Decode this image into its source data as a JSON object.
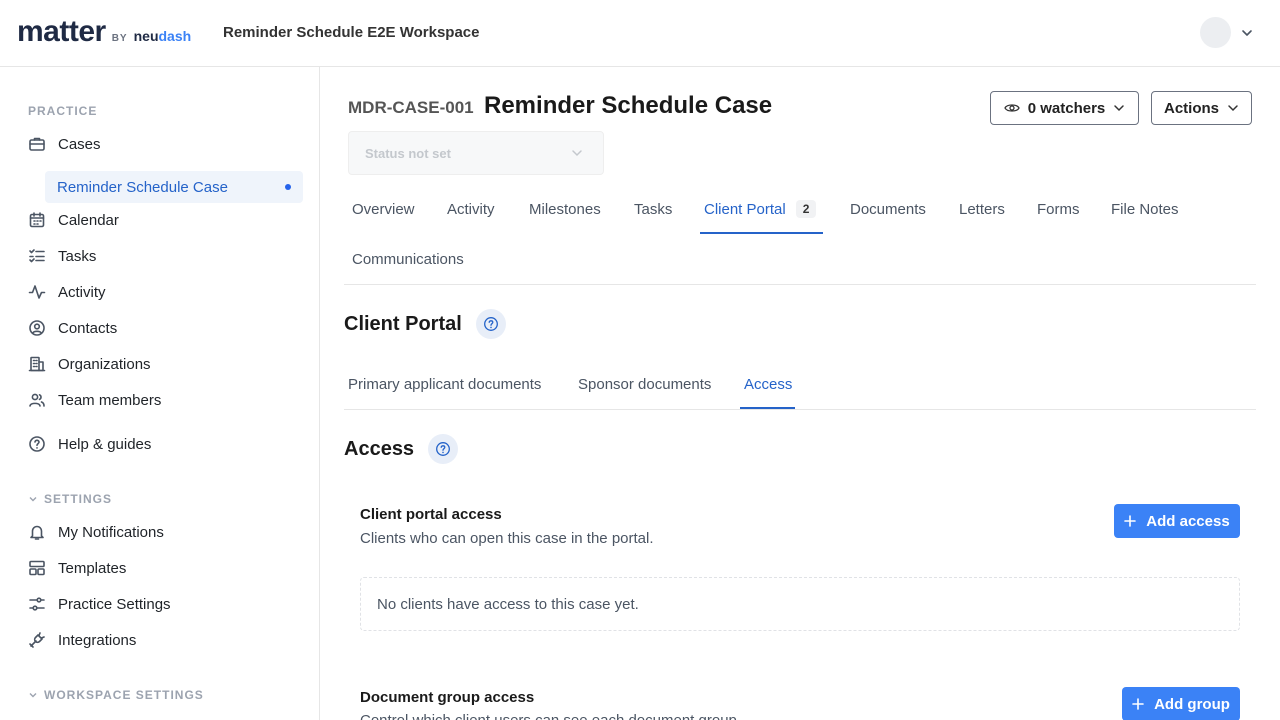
{
  "header": {
    "logo_main": "matter",
    "logo_by": "BY",
    "logo_neu": "neu",
    "logo_dash": "dash",
    "workspace": "Reminder Schedule E2E Workspace"
  },
  "sidebar": {
    "practice_label": "PRACTICE",
    "cases": "Cases",
    "active_case": "Reminder Schedule Case",
    "calendar": "Calendar",
    "tasks": "Tasks",
    "activity": "Activity",
    "contacts": "Contacts",
    "organizations": "Organizations",
    "team_members": "Team members",
    "help": "Help & guides",
    "settings_label": "SETTINGS",
    "my_notifications": "My Notifications",
    "templates": "Templates",
    "practice_settings": "Practice Settings",
    "integrations": "Integrations",
    "workspace_settings_label": "WORKSPACE SETTINGS"
  },
  "case": {
    "id": "MDR-CASE-001",
    "title": "Reminder Schedule Case",
    "status_placeholder": "Status not set",
    "watchers": "0 watchers",
    "actions": "Actions"
  },
  "tabs": {
    "overview": "Overview",
    "activity": "Activity",
    "milestones": "Milestones",
    "tasks": "Tasks",
    "client_portal": "Client Portal",
    "client_portal_count": "2",
    "documents": "Documents",
    "letters": "Letters",
    "forms": "Forms",
    "file_notes": "File Notes",
    "communications": "Communications"
  },
  "portal": {
    "heading": "Client Portal",
    "subtabs": {
      "primary": "Primary applicant documents",
      "sponsor": "Sponsor documents",
      "access": "Access"
    },
    "access_heading": "Access",
    "client_access_title": "Client portal access",
    "client_access_desc": "Clients who can open this case in the portal.",
    "add_access": "Add access",
    "empty_message": "No clients have access to this case yet.",
    "group_access_title": "Document group access",
    "group_access_desc": "Control which client users can see each document group.",
    "add_group": "Add group"
  },
  "colors": {
    "accent": "#2563c9",
    "primary_button": "#3b82f6"
  }
}
